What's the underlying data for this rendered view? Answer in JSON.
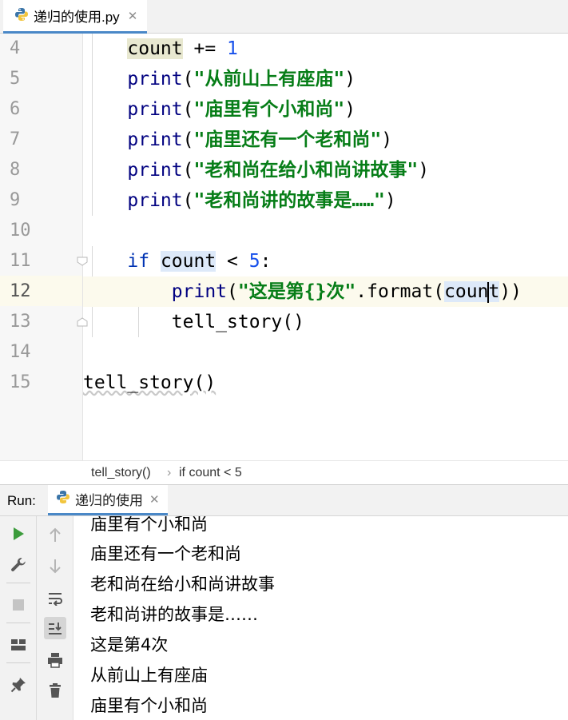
{
  "editor_tab": {
    "filename": "递归的使用.py",
    "icon": "python-icon"
  },
  "editor": {
    "line_numbers": [
      "4",
      "5",
      "6",
      "7",
      "8",
      "9",
      "10",
      "11",
      "12",
      "13",
      "14",
      "15"
    ],
    "lines": {
      "l4": {
        "var": "count",
        "op": " += ",
        "num": "1"
      },
      "l5": {
        "fn": "print",
        "open": "(",
        "str": "\"从前山上有座庙\"",
        "close": ")"
      },
      "l6": {
        "fn": "print",
        "open": "(",
        "str": "\"庙里有个小和尚\"",
        "close": ")"
      },
      "l7": {
        "fn": "print",
        "open": "(",
        "str": "\"庙里还有一个老和尚\"",
        "close": ")"
      },
      "l8": {
        "fn": "print",
        "open": "(",
        "str": "\"老和尚在给小和尚讲故事\"",
        "close": ")"
      },
      "l9": {
        "fn": "print",
        "open": "(",
        "str": "\"老和尚讲的故事是……\"",
        "close": ")"
      },
      "l11": {
        "kw": "if",
        "var": "count",
        "op": " < ",
        "num": "5",
        "colon": ":"
      },
      "l12": {
        "fn": "print",
        "open": "(",
        "str": "\"这是第{}次\"",
        "method": ".format(",
        "var_a": "coun",
        "var_b": "t",
        "close": "))"
      },
      "l13": {
        "call": "tell_story()"
      },
      "l15": {
        "call": "tell_story()"
      }
    },
    "current_line": "12"
  },
  "breadcrumb": {
    "item1": "tell_story()",
    "separator": "›",
    "item2": "if count < 5"
  },
  "run": {
    "label": "Run:",
    "tab_label": "递归的使用",
    "output": [
      "庙里有个小和尚",
      "庙里还有一个老和尚",
      "老和尚在给小和尚讲故事",
      "老和尚讲的故事是……",
      "这是第4次",
      "从前山上有座庙",
      "庙里有个小和尚"
    ]
  },
  "colors": {
    "keyword": "#0033b3",
    "string": "#067d17",
    "number": "#1750eb",
    "current_line_bg": "#fcfaed",
    "identifier_highlight": "#dde9f9",
    "run_icon": "#3c9c3c",
    "tab_underline": "#4a88c7"
  },
  "icons": {
    "tools_col1": [
      "run-icon",
      "wrench-icon",
      "stop-icon",
      "layout-icon",
      "pin-icon"
    ],
    "tools_col2": [
      "up-arrow-icon",
      "down-arrow-icon",
      "soft-wrap-icon",
      "scroll-to-end-icon",
      "print-icon",
      "trash-icon"
    ]
  }
}
